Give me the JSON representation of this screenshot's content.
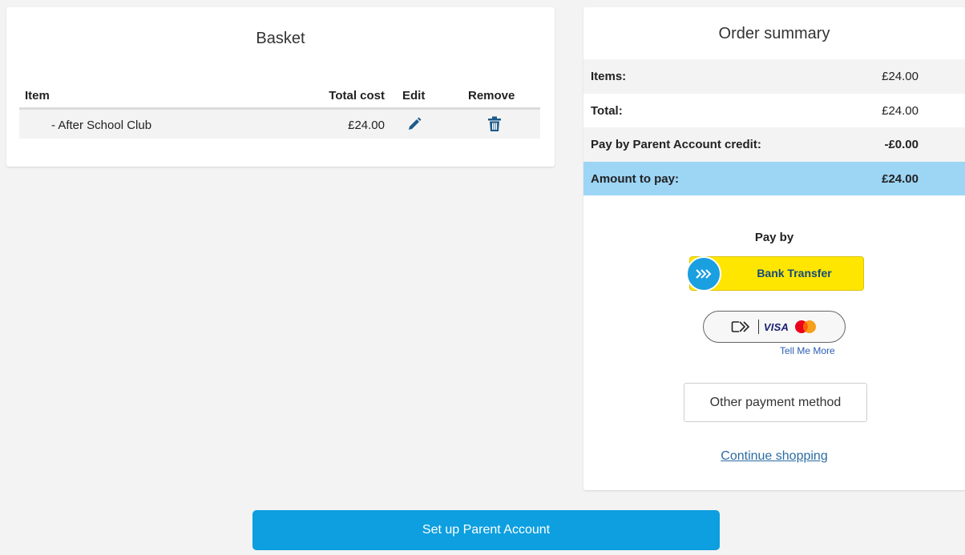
{
  "basket": {
    "title": "Basket",
    "columns": {
      "item": "Item",
      "total_cost": "Total cost",
      "edit": "Edit",
      "remove": "Remove"
    },
    "rows": [
      {
        "name": "- After School Club",
        "cost": "£24.00"
      }
    ]
  },
  "summary": {
    "title": "Order summary",
    "rows": [
      {
        "label": "Items:",
        "value": "£24.00"
      },
      {
        "label": "Total:",
        "value": "£24.00"
      },
      {
        "label": "Pay by Parent Account credit:",
        "value": "-£0.00"
      },
      {
        "label": "Amount to pay:",
        "value": "£24.00"
      }
    ],
    "pay_by": "Pay by",
    "bank_transfer": "Bank Transfer",
    "card_brand": "VISA",
    "tell_me_more": "Tell Me More",
    "other_payment": "Other payment method",
    "continue_shopping": "Continue shopping"
  },
  "setup_button": "Set up Parent Account",
  "colors": {
    "primary": "#0d9fdf",
    "highlight_row": "#9dd5f5",
    "bank_yellow": "#ffe600",
    "bank_blue": "#1a9fe0",
    "icon_blue": "#1c5a8a",
    "link": "#2b6ca3"
  },
  "icons": {
    "edit": "pencil-icon",
    "remove": "trash-icon",
    "bank": "chevrons-right-icon",
    "card": "contactless-card-icon",
    "mastercard": "mastercard-icon"
  }
}
